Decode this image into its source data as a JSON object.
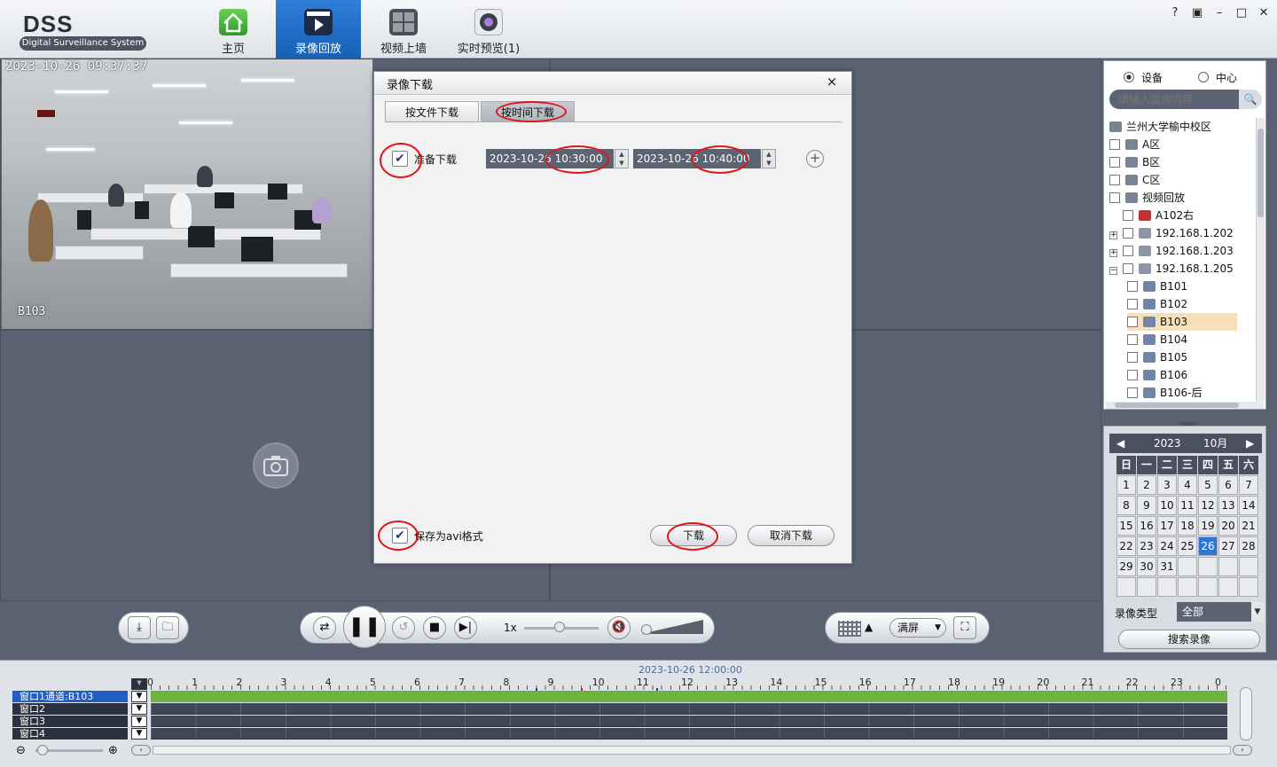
{
  "app": {
    "title": "DSS",
    "subtitle": "Digital Surveillance System"
  },
  "nav": [
    {
      "label": "主页",
      "icon": "home-icon"
    },
    {
      "label": "录像回放",
      "icon": "playback-icon",
      "active": true
    },
    {
      "label": "视频上墙",
      "icon": "video-wall-icon"
    },
    {
      "label": "实时预览(1)",
      "icon": "live-preview-icon"
    }
  ],
  "window_buttons": [
    "?",
    "🔒",
    "–",
    "□",
    "✕"
  ],
  "video": {
    "timestamp": "2023-10-26 09:37:37",
    "camera": "B103"
  },
  "dialog": {
    "title": "录像下载",
    "close": "×",
    "tabs": [
      {
        "label": "按文件下载",
        "selected": false
      },
      {
        "label": "按时间下载",
        "selected": true
      }
    ],
    "prepare_label": "准备下载",
    "prepare_checked": true,
    "start_date": "2023-10-26",
    "start_time": "10:30:00",
    "end_date": "2023-10-26",
    "end_time": "10:40:00",
    "add": "+",
    "save_avi_label": "保存为avi格式",
    "save_avi_checked": true,
    "download_button": "下载",
    "cancel_button": "取消下载"
  },
  "right": {
    "radio_device": "设备",
    "radio_center": "中心",
    "radio_selected": "设备",
    "search_placeholder": "请输入查询内容",
    "tree": [
      {
        "label": "兰州大学榆中校区",
        "level": 0,
        "type": "org",
        "checkbox": false
      },
      {
        "label": "A区",
        "level": 0,
        "type": "org",
        "checkbox": true
      },
      {
        "label": "B区",
        "level": 0,
        "type": "org",
        "checkbox": true
      },
      {
        "label": "C区",
        "level": 0,
        "type": "org",
        "checkbox": true
      },
      {
        "label": "视频回放",
        "level": 0,
        "type": "org",
        "checkbox": true
      },
      {
        "label": "A102右",
        "level": 1,
        "type": "cam-red",
        "checkbox": true
      },
      {
        "label": "192.168.1.202",
        "level": 1,
        "type": "dvr",
        "checkbox": true,
        "expander": "+"
      },
      {
        "label": "192.168.1.203",
        "level": 1,
        "type": "dvr",
        "checkbox": true,
        "expander": "+"
      },
      {
        "label": "192.168.1.205",
        "level": 1,
        "type": "dvr",
        "checkbox": true,
        "expander": "−"
      },
      {
        "label": "B101",
        "level": 2,
        "type": "cam",
        "checkbox": true
      },
      {
        "label": "B102",
        "level": 2,
        "type": "cam",
        "checkbox": true
      },
      {
        "label": "B103",
        "level": 2,
        "type": "cam",
        "checkbox": true,
        "highlight": true
      },
      {
        "label": "B104",
        "level": 2,
        "type": "cam",
        "checkbox": true
      },
      {
        "label": "B105",
        "level": 2,
        "type": "cam",
        "checkbox": true
      },
      {
        "label": "B106",
        "level": 2,
        "type": "cam",
        "checkbox": true
      },
      {
        "label": "B106-后",
        "level": 2,
        "type": "cam",
        "checkbox": true
      }
    ]
  },
  "calendar": {
    "year": "2023",
    "month": "10月",
    "weekdays": [
      "日",
      "一",
      "二",
      "三",
      "四",
      "五",
      "六"
    ],
    "days": [
      "1",
      "2",
      "3",
      "4",
      "5",
      "6",
      "7",
      "8",
      "9",
      "10",
      "11",
      "12",
      "13",
      "14",
      "15",
      "16",
      "17",
      "18",
      "19",
      "20",
      "21",
      "22",
      "23",
      "24",
      "25",
      "26",
      "27",
      "28",
      "29",
      "30",
      "31",
      "",
      "",
      "",
      "",
      "",
      "",
      "",
      "",
      "",
      "",
      ""
    ],
    "selected": "26",
    "record_type_label": "录像类型",
    "record_type_value": "全部",
    "search_button": "搜索录像"
  },
  "controls": {
    "speed": "1x",
    "fullscreen": "满屏"
  },
  "timeline": {
    "date": "2023-10-26 12:00:00",
    "hours": [
      "0",
      "1",
      "2",
      "3",
      "4",
      "5",
      "6",
      "7",
      "8",
      "9",
      "10",
      "11",
      "12",
      "13",
      "14",
      "15",
      "16",
      "17",
      "18",
      "19",
      "20",
      "21",
      "22",
      "23",
      "0"
    ],
    "rows": [
      "窗口1通道:B103",
      "窗口2",
      "窗口3",
      "窗口4"
    ],
    "record_color": "#6db33f",
    "recorded_span_hours": [
      0,
      24
    ]
  }
}
